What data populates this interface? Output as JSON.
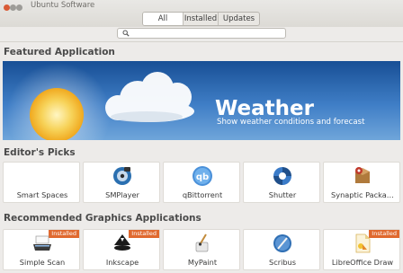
{
  "window": {
    "title": "Ubuntu Software"
  },
  "tabs": [
    {
      "label": "All",
      "active": true
    },
    {
      "label": "Installed",
      "active": false
    },
    {
      "label": "Updates",
      "active": false
    }
  ],
  "search": {
    "placeholder": ""
  },
  "featured": {
    "heading": "Featured Application",
    "title": "Weather",
    "subtitle": "Show weather conditions and forecast"
  },
  "editors_picks": {
    "heading": "Editor's Picks",
    "apps": [
      {
        "name": "Smart Spaces",
        "icon": "no-icon"
      },
      {
        "name": "SMPlayer",
        "icon": "smplayer-icon"
      },
      {
        "name": "qBittorrent",
        "icon": "qbittorrent-icon"
      },
      {
        "name": "Shutter",
        "icon": "shutter-icon"
      },
      {
        "name": "Synaptic Packa…",
        "icon": "synaptic-icon"
      }
    ]
  },
  "graphics": {
    "heading": "Recommended Graphics Applications",
    "apps": [
      {
        "name": "Simple Scan",
        "icon": "scanner-icon",
        "badge": "Installed"
      },
      {
        "name": "Inkscape",
        "icon": "inkscape-icon",
        "badge": "Installed"
      },
      {
        "name": "MyPaint",
        "icon": "mypaint-icon",
        "badge": ""
      },
      {
        "name": "Scribus",
        "icon": "scribus-icon",
        "badge": ""
      },
      {
        "name": "LibreOffice Draw",
        "icon": "libreoffice-draw-icon",
        "badge": "Installed"
      }
    ]
  },
  "colors": {
    "accent": "#e0692f",
    "banner_top": "#184f95",
    "banner_bottom": "#6fa5da",
    "background": "#edebe9"
  }
}
